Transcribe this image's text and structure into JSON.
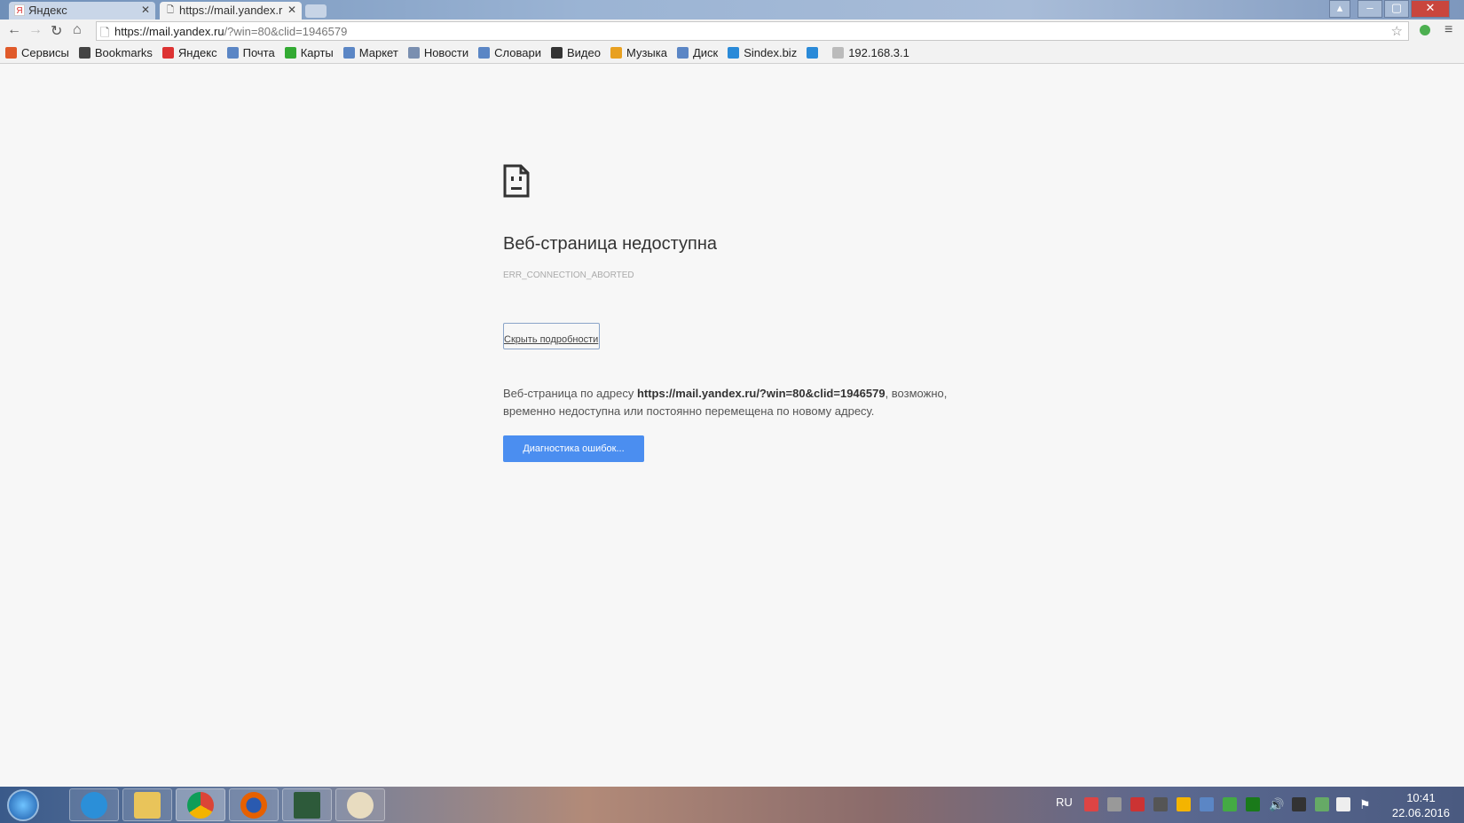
{
  "tabs": [
    {
      "label": "Яндекс",
      "favicon": "Я"
    },
    {
      "label": "https://mail.yandex.r"
    }
  ],
  "toolbar": {
    "url_host": "https://mail.yandex.ru",
    "url_rest": "/?win=80&clid=1946579"
  },
  "bookmarks": [
    {
      "label": "Сервисы",
      "icon": "apps-icon",
      "color": "#e05a2a"
    },
    {
      "label": "Bookmarks",
      "icon": "star-icon",
      "color": "#444"
    },
    {
      "label": "Яндекс",
      "icon": "yandex-icon",
      "color": "#d33"
    },
    {
      "label": "Почта",
      "icon": "mail-icon",
      "color": "#5b86c5"
    },
    {
      "label": "Карты",
      "icon": "maps-icon",
      "color": "#3a3"
    },
    {
      "label": "Маркет",
      "icon": "market-icon",
      "color": "#5b86c5"
    },
    {
      "label": "Новости",
      "icon": "news-icon",
      "color": "#7a8fb0"
    },
    {
      "label": "Словари",
      "icon": "dictionary-icon",
      "color": "#5b86c5"
    },
    {
      "label": "Видео",
      "icon": "video-icon",
      "color": "#333"
    },
    {
      "label": "Музыка",
      "icon": "music-icon",
      "color": "#e8a020"
    },
    {
      "label": "Диск",
      "icon": "disk-icon",
      "color": "#5b86c5"
    },
    {
      "label": "Sindex.biz",
      "icon": "play-icon",
      "color": "#2a8ad8"
    },
    {
      "label": "",
      "icon": "vk-icon",
      "color": "#2a8ad8"
    },
    {
      "label": "192.168.3.1",
      "icon": "page-icon",
      "color": "#bbb"
    }
  ],
  "error": {
    "title": "Веб-страница недоступна",
    "code": "ERR_CONNECTION_ABORTED",
    "details_button": "Скрыть подробности",
    "desc_prefix": "Веб-страница по адресу ",
    "desc_url": "https://mail.yandex.ru/?win=80&clid=1946579",
    "desc_suffix": ", возможно, временно недоступна или постоянно перемещена по новому адресу.",
    "diagnose_button": "Диагностика ошибок..."
  },
  "taskbar": {
    "language": "RU",
    "time": "10:41",
    "date": "22.06.2016"
  }
}
